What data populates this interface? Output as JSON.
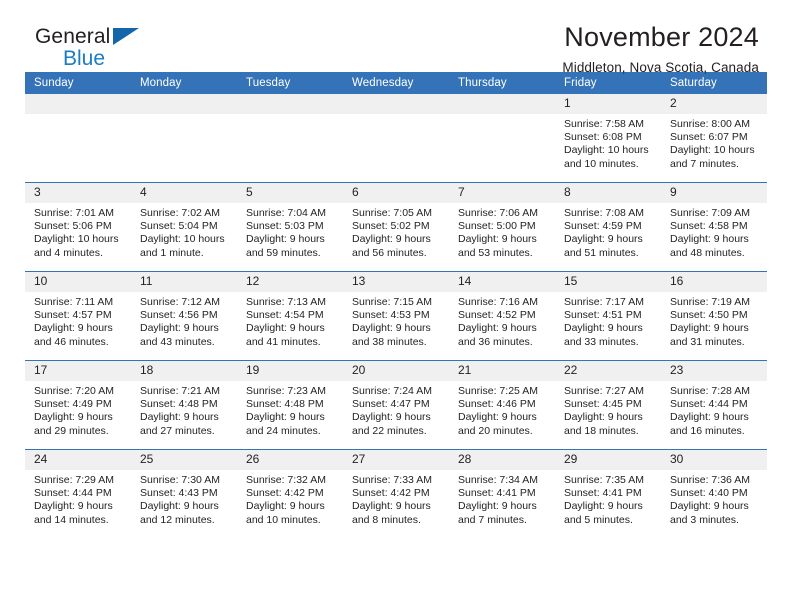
{
  "brand": {
    "name_top": "General",
    "name_bottom": "Blue",
    "triangle_color": "#1565ab",
    "blue_color": "#1a7dc4"
  },
  "header": {
    "title": "November 2024",
    "subtitle": "Middleton, Nova Scotia, Canada"
  },
  "calendar": {
    "header_bg": "#3573b9",
    "daynum_bg": "#f0f0f0",
    "weekday_headers": [
      "Sunday",
      "Monday",
      "Tuesday",
      "Wednesday",
      "Thursday",
      "Friday",
      "Saturday"
    ],
    "weeks": [
      [
        {
          "day": "",
          "blank": true
        },
        {
          "day": "",
          "blank": true
        },
        {
          "day": "",
          "blank": true
        },
        {
          "day": "",
          "blank": true
        },
        {
          "day": "",
          "blank": true
        },
        {
          "day": "1",
          "sunrise": "Sunrise: 7:58 AM",
          "sunset": "Sunset: 6:08 PM",
          "daylight": "Daylight: 10 hours and 10 minutes."
        },
        {
          "day": "2",
          "sunrise": "Sunrise: 8:00 AM",
          "sunset": "Sunset: 6:07 PM",
          "daylight": "Daylight: 10 hours and 7 minutes."
        }
      ],
      [
        {
          "day": "3",
          "sunrise": "Sunrise: 7:01 AM",
          "sunset": "Sunset: 5:06 PM",
          "daylight": "Daylight: 10 hours and 4 minutes."
        },
        {
          "day": "4",
          "sunrise": "Sunrise: 7:02 AM",
          "sunset": "Sunset: 5:04 PM",
          "daylight": "Daylight: 10 hours and 1 minute."
        },
        {
          "day": "5",
          "sunrise": "Sunrise: 7:04 AM",
          "sunset": "Sunset: 5:03 PM",
          "daylight": "Daylight: 9 hours and 59 minutes."
        },
        {
          "day": "6",
          "sunrise": "Sunrise: 7:05 AM",
          "sunset": "Sunset: 5:02 PM",
          "daylight": "Daylight: 9 hours and 56 minutes."
        },
        {
          "day": "7",
          "sunrise": "Sunrise: 7:06 AM",
          "sunset": "Sunset: 5:00 PM",
          "daylight": "Daylight: 9 hours and 53 minutes."
        },
        {
          "day": "8",
          "sunrise": "Sunrise: 7:08 AM",
          "sunset": "Sunset: 4:59 PM",
          "daylight": "Daylight: 9 hours and 51 minutes."
        },
        {
          "day": "9",
          "sunrise": "Sunrise: 7:09 AM",
          "sunset": "Sunset: 4:58 PM",
          "daylight": "Daylight: 9 hours and 48 minutes."
        }
      ],
      [
        {
          "day": "10",
          "sunrise": "Sunrise: 7:11 AM",
          "sunset": "Sunset: 4:57 PM",
          "daylight": "Daylight: 9 hours and 46 minutes."
        },
        {
          "day": "11",
          "sunrise": "Sunrise: 7:12 AM",
          "sunset": "Sunset: 4:56 PM",
          "daylight": "Daylight: 9 hours and 43 minutes."
        },
        {
          "day": "12",
          "sunrise": "Sunrise: 7:13 AM",
          "sunset": "Sunset: 4:54 PM",
          "daylight": "Daylight: 9 hours and 41 minutes."
        },
        {
          "day": "13",
          "sunrise": "Sunrise: 7:15 AM",
          "sunset": "Sunset: 4:53 PM",
          "daylight": "Daylight: 9 hours and 38 minutes."
        },
        {
          "day": "14",
          "sunrise": "Sunrise: 7:16 AM",
          "sunset": "Sunset: 4:52 PM",
          "daylight": "Daylight: 9 hours and 36 minutes."
        },
        {
          "day": "15",
          "sunrise": "Sunrise: 7:17 AM",
          "sunset": "Sunset: 4:51 PM",
          "daylight": "Daylight: 9 hours and 33 minutes."
        },
        {
          "day": "16",
          "sunrise": "Sunrise: 7:19 AM",
          "sunset": "Sunset: 4:50 PM",
          "daylight": "Daylight: 9 hours and 31 minutes."
        }
      ],
      [
        {
          "day": "17",
          "sunrise": "Sunrise: 7:20 AM",
          "sunset": "Sunset: 4:49 PM",
          "daylight": "Daylight: 9 hours and 29 minutes."
        },
        {
          "day": "18",
          "sunrise": "Sunrise: 7:21 AM",
          "sunset": "Sunset: 4:48 PM",
          "daylight": "Daylight: 9 hours and 27 minutes."
        },
        {
          "day": "19",
          "sunrise": "Sunrise: 7:23 AM",
          "sunset": "Sunset: 4:48 PM",
          "daylight": "Daylight: 9 hours and 24 minutes."
        },
        {
          "day": "20",
          "sunrise": "Sunrise: 7:24 AM",
          "sunset": "Sunset: 4:47 PM",
          "daylight": "Daylight: 9 hours and 22 minutes."
        },
        {
          "day": "21",
          "sunrise": "Sunrise: 7:25 AM",
          "sunset": "Sunset: 4:46 PM",
          "daylight": "Daylight: 9 hours and 20 minutes."
        },
        {
          "day": "22",
          "sunrise": "Sunrise: 7:27 AM",
          "sunset": "Sunset: 4:45 PM",
          "daylight": "Daylight: 9 hours and 18 minutes."
        },
        {
          "day": "23",
          "sunrise": "Sunrise: 7:28 AM",
          "sunset": "Sunset: 4:44 PM",
          "daylight": "Daylight: 9 hours and 16 minutes."
        }
      ],
      [
        {
          "day": "24",
          "sunrise": "Sunrise: 7:29 AM",
          "sunset": "Sunset: 4:44 PM",
          "daylight": "Daylight: 9 hours and 14 minutes."
        },
        {
          "day": "25",
          "sunrise": "Sunrise: 7:30 AM",
          "sunset": "Sunset: 4:43 PM",
          "daylight": "Daylight: 9 hours and 12 minutes."
        },
        {
          "day": "26",
          "sunrise": "Sunrise: 7:32 AM",
          "sunset": "Sunset: 4:42 PM",
          "daylight": "Daylight: 9 hours and 10 minutes."
        },
        {
          "day": "27",
          "sunrise": "Sunrise: 7:33 AM",
          "sunset": "Sunset: 4:42 PM",
          "daylight": "Daylight: 9 hours and 8 minutes."
        },
        {
          "day": "28",
          "sunrise": "Sunrise: 7:34 AM",
          "sunset": "Sunset: 4:41 PM",
          "daylight": "Daylight: 9 hours and 7 minutes."
        },
        {
          "day": "29",
          "sunrise": "Sunrise: 7:35 AM",
          "sunset": "Sunset: 4:41 PM",
          "daylight": "Daylight: 9 hours and 5 minutes."
        },
        {
          "day": "30",
          "sunrise": "Sunrise: 7:36 AM",
          "sunset": "Sunset: 4:40 PM",
          "daylight": "Daylight: 9 hours and 3 minutes."
        }
      ]
    ]
  }
}
